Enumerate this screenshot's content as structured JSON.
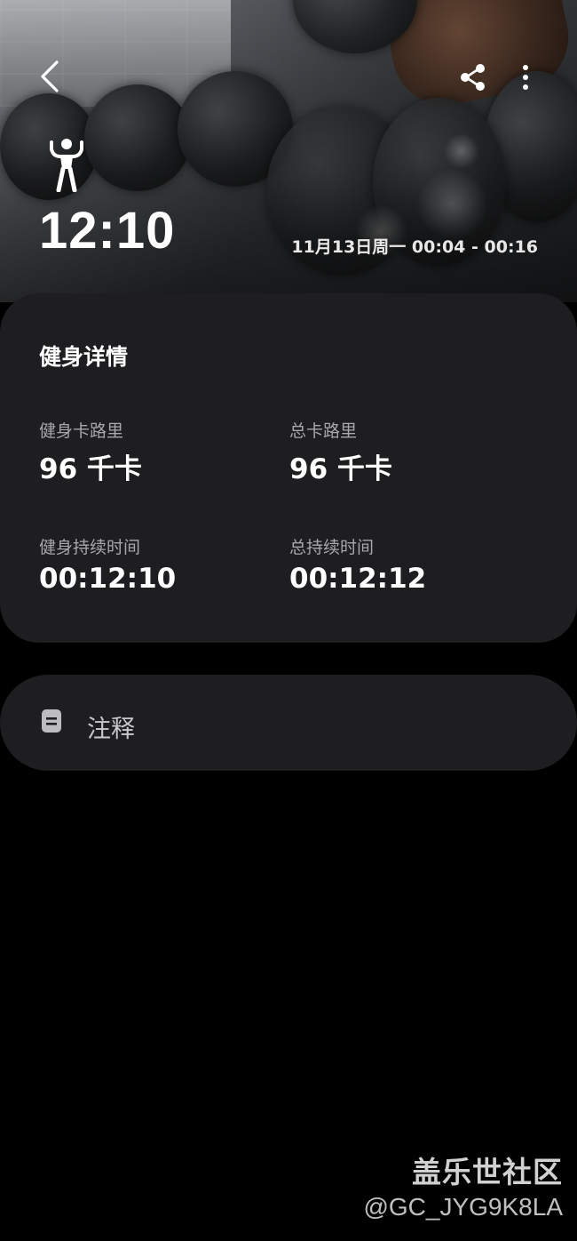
{
  "header": {
    "back_icon": "chevron-left-icon",
    "share_icon": "share-icon",
    "more_icon": "more-vertical-icon",
    "workout_type_icon": "strength-workout-icon",
    "workout_duration": "12:10",
    "date_range": "11月13日周一 00:04 - 00:16"
  },
  "details": {
    "title": "健身详情",
    "stats": [
      {
        "label": "健身卡路里",
        "value": "96 千卡"
      },
      {
        "label": "总卡路里",
        "value": "96 千卡"
      },
      {
        "label": "健身持续时间",
        "value": "00:12:10"
      },
      {
        "label": "总持续时间",
        "value": "00:12:12"
      }
    ]
  },
  "notes": {
    "icon": "note-icon",
    "label": "注释"
  },
  "watermark": {
    "title": "盖乐世社区",
    "handle": "@GC_JYG9K8LA"
  }
}
